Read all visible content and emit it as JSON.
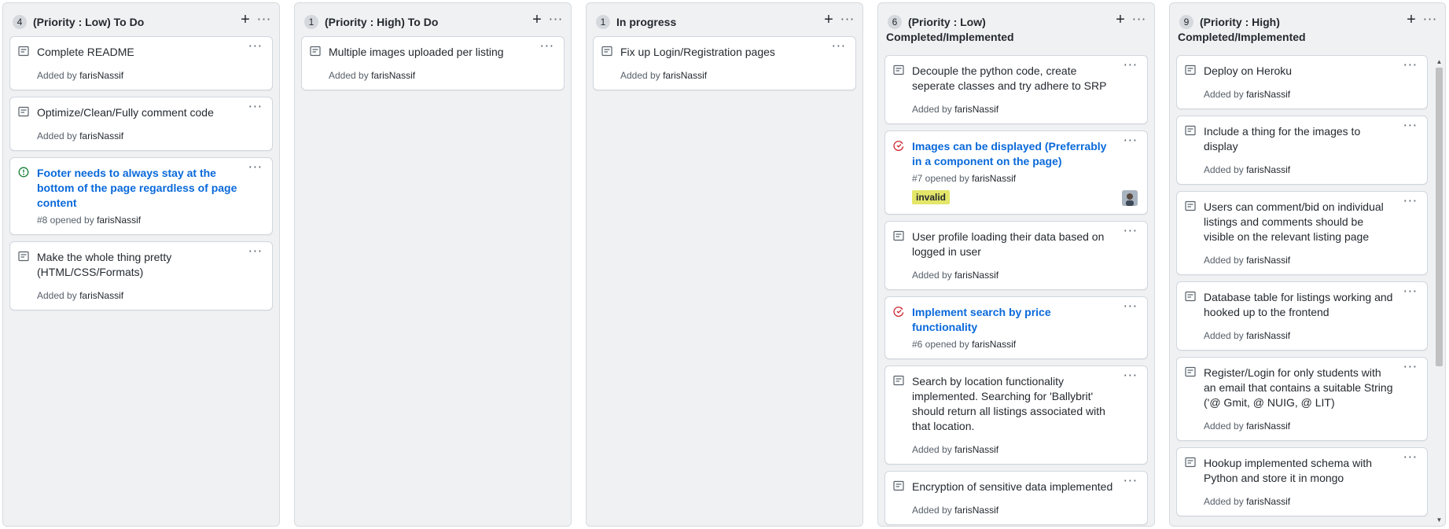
{
  "columns": [
    {
      "count": "4",
      "title": "(Priority : Low) To Do",
      "cards": [
        {
          "type": "note",
          "title": "Complete README",
          "meta_prefix": "Added by",
          "author": "farisNassif"
        },
        {
          "type": "note",
          "title": "Optimize/Clean/Fully comment code",
          "meta_prefix": "Added by",
          "author": "farisNassif"
        },
        {
          "type": "issue-open",
          "title": "Footer needs to always stay at the bottom of the page regardless of page content",
          "meta_prefix": "#8 opened by",
          "author": "farisNassif"
        },
        {
          "type": "note",
          "title": "Make the whole thing pretty (HTML/CSS/Formats)",
          "meta_prefix": "Added by",
          "author": "farisNassif"
        }
      ]
    },
    {
      "count": "1",
      "title": "(Priority : High) To Do",
      "cards": [
        {
          "type": "note",
          "title": "Multiple images uploaded per listing",
          "meta_prefix": "Added by",
          "author": "farisNassif"
        }
      ]
    },
    {
      "count": "1",
      "title": "In progress",
      "cards": [
        {
          "type": "note",
          "title": "Fix up Login/Registration pages",
          "meta_prefix": "Added by",
          "author": "farisNassif"
        }
      ]
    },
    {
      "count": "6",
      "title": "(Priority : Low) Completed/Implemented",
      "cards": [
        {
          "type": "note",
          "title": "Decouple the python code, create seperate classes and try adhere to SRP",
          "meta_prefix": "Added by",
          "author": "farisNassif"
        },
        {
          "type": "issue-closed",
          "title": "Images can be displayed (Preferrably in a component on the page)",
          "meta_prefix": "#7 opened by",
          "author": "farisNassif",
          "label": "invalid",
          "has_avatar": true
        },
        {
          "type": "note",
          "title": "User profile loading their data based on logged in user",
          "meta_prefix": "Added by",
          "author": "farisNassif"
        },
        {
          "type": "issue-closed",
          "title": "Implement search by price functionality",
          "meta_prefix": "#6 opened by",
          "author": "farisNassif"
        },
        {
          "type": "note",
          "title": "Search by location functionality implemented. Searching for 'Ballybrit' should return all listings associated with that location.",
          "meta_prefix": "Added by",
          "author": "farisNassif"
        },
        {
          "type": "note",
          "title": "Encryption of sensitive data implemented",
          "meta_prefix": "Added by",
          "author": "farisNassif"
        }
      ]
    },
    {
      "count": "9",
      "title": "(Priority : High) Completed/Implemented",
      "cards": [
        {
          "type": "note",
          "title": "Deploy on Heroku",
          "meta_prefix": "Added by",
          "author": "farisNassif"
        },
        {
          "type": "note",
          "title": "Include a thing for the images to display",
          "meta_prefix": "Added by",
          "author": "farisNassif"
        },
        {
          "type": "note",
          "title": "Users can comment/bid on individual listings and comments should be visible on the relevant listing page",
          "meta_prefix": "Added by",
          "author": "farisNassif"
        },
        {
          "type": "note",
          "title": "Database table for listings working and hooked up to the frontend",
          "meta_prefix": "Added by",
          "author": "farisNassif"
        },
        {
          "type": "note",
          "title": "Register/Login for only students with an email that contains a suitable String ('@ Gmit, @ NUIG, @ LIT)",
          "meta_prefix": "Added by",
          "author": "farisNassif"
        },
        {
          "type": "note",
          "title": "Hookup implemented schema with Python and store it in mongo",
          "meta_prefix": "Added by",
          "author": "farisNassif"
        }
      ]
    }
  ],
  "icons": {
    "add": "+",
    "more": "···",
    "scroll_up": "▲",
    "scroll_down": "▼"
  },
  "colors": {
    "issue_open": "#1a7f37",
    "issue_closed": "#cf222e",
    "link": "#0969da",
    "label_invalid": "#e4e669"
  }
}
